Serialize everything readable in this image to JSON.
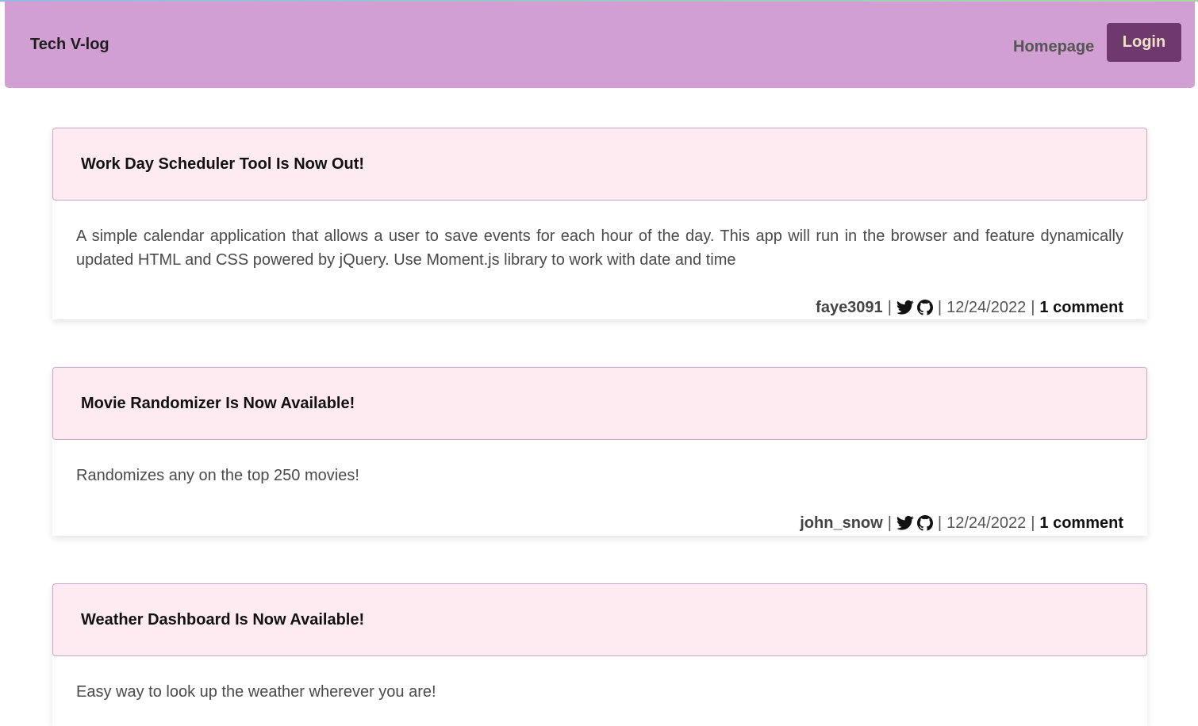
{
  "nav": {
    "brand": "Tech V-log",
    "homepage": "Homepage",
    "login": "Login"
  },
  "posts": [
    {
      "title": "Work Day Scheduler Tool Is Now Out!",
      "body": "A simple calendar application that allows a user to save events for each hour of the day. This app will run in the browser and feature dynamically updated HTML and CSS powered by jQuery. Use Moment.js library to work with date and time",
      "author": "faye3091",
      "date": "12/24/2022",
      "comments": "1 comment"
    },
    {
      "title": "Movie Randomizer Is Now Available!",
      "body": "Randomizes any on the top 250 movies!",
      "author": "john_snow",
      "date": "12/24/2022",
      "comments": "1 comment"
    },
    {
      "title": "Weather Dashboard Is Now Available!",
      "body": "Easy way to look up the weather wherever you are!"
    }
  ],
  "footer_separator": "|",
  "icons": [
    "twitter-icon",
    "github-icon"
  ],
  "colors": {
    "navbar": "#d19fd1",
    "login_button": "#6e3a6e",
    "post_header": "#feebf1"
  }
}
